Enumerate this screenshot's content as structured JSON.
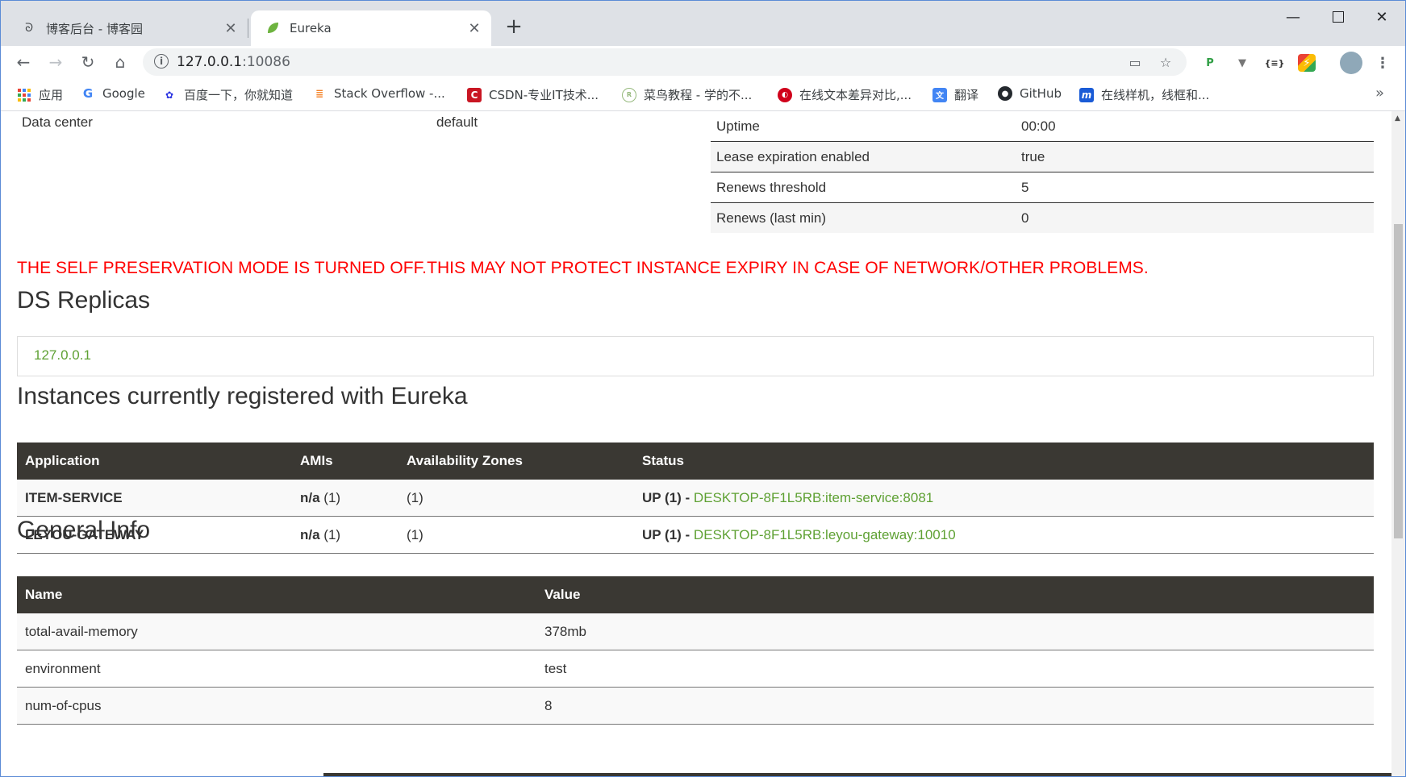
{
  "browser": {
    "tabs": [
      {
        "title": "博客后台 - 博客园",
        "active": false
      },
      {
        "title": "Eureka",
        "active": true
      }
    ],
    "url_host": "127.0.0.1",
    "url_port": ":10086",
    "bookmarks": [
      {
        "label": "应用",
        "icon": "apps-grid-icon",
        "color": "#4285f4"
      },
      {
        "label": "Google",
        "icon": "google-icon",
        "color": "#4285f4"
      },
      {
        "label": "百度一下，你就知道",
        "icon": "baidu-paw-icon",
        "color": "#2932e1"
      },
      {
        "label": "Stack Overflow -...",
        "icon": "stackoverflow-icon",
        "color": "#f48024"
      },
      {
        "label": "CSDN-专业IT技术...",
        "icon": "csdn-icon",
        "color": "#c91623"
      },
      {
        "label": "菜鸟教程 - 学的不...",
        "icon": "runoob-icon",
        "color": "#96b97d"
      },
      {
        "label": "在线文本差异对比,...",
        "icon": "diff-icon",
        "color": "#d0021b"
      },
      {
        "label": "翻译",
        "icon": "translate-icon",
        "color": "#4285f4"
      },
      {
        "label": "GitHub",
        "icon": "github-icon",
        "color": "#24292e"
      },
      {
        "label": "在线样机，线框和...",
        "icon": "modao-icon",
        "color": "#1a5bd6"
      }
    ],
    "more_glyph": "»"
  },
  "eureka": {
    "data_center_label": "Data center",
    "data_center_value": "default",
    "stats": [
      {
        "label": "Uptime",
        "value": "00:00"
      },
      {
        "label": "Lease expiration enabled",
        "value": "true"
      },
      {
        "label": "Renews threshold",
        "value": "5"
      },
      {
        "label": "Renews (last min)",
        "value": "0"
      }
    ],
    "warning": "THE SELF PRESERVATION MODE IS TURNED OFF.THIS MAY NOT PROTECT INSTANCE EXPIRY IN CASE OF NETWORK/OTHER PROBLEMS.",
    "replicas_title": "DS Replicas",
    "replica": "127.0.0.1",
    "instances_title": "Instances currently registered with Eureka",
    "instances_headers": [
      "Application",
      "AMIs",
      "Availability Zones",
      "Status"
    ],
    "instances": [
      {
        "application": "ITEM-SERVICE",
        "amis_label": "n/a",
        "amis_count": " (1)",
        "zones": "(1)",
        "status": "UP (1) - ",
        "link": "DESKTOP-8F1L5RB:item-service:8081"
      },
      {
        "application": "LEYOU-GATEWAY",
        "amis_label": "n/a",
        "amis_count": " (1)",
        "zones": "(1)",
        "status": "UP (1) - ",
        "link": "DESKTOP-8F1L5RB:leyou-gateway:10010"
      }
    ],
    "general_title": "General Info",
    "general_headers": [
      "Name",
      "Value"
    ],
    "general": [
      {
        "name": "total-avail-memory",
        "value": "378mb"
      },
      {
        "name": "environment",
        "value": "test"
      },
      {
        "name": "num-of-cpus",
        "value": "8"
      }
    ]
  }
}
